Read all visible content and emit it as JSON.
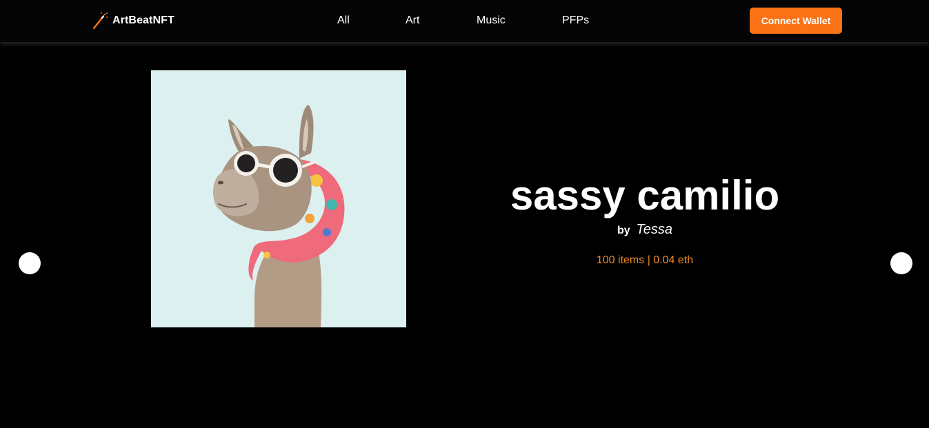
{
  "brand": {
    "name": "ArtBeatNFT",
    "icon": "magic-wand-icon",
    "accent_color": "#f97316"
  },
  "nav": {
    "links": [
      {
        "label": "All"
      },
      {
        "label": "Art"
      },
      {
        "label": "Music"
      },
      {
        "label": "PFPs"
      }
    ],
    "connect_label": "Connect Wallet"
  },
  "featured": {
    "artwork_icon": "llama-artwork",
    "title": "sassy camilio",
    "by_label": "by",
    "artist": "Tessa",
    "stats": "100 items | 0.04 eth",
    "stats_color": "#f08a24"
  },
  "carousel": {
    "prev_icon": "previous-dot-icon",
    "next_icon": "next-dot-icon"
  }
}
